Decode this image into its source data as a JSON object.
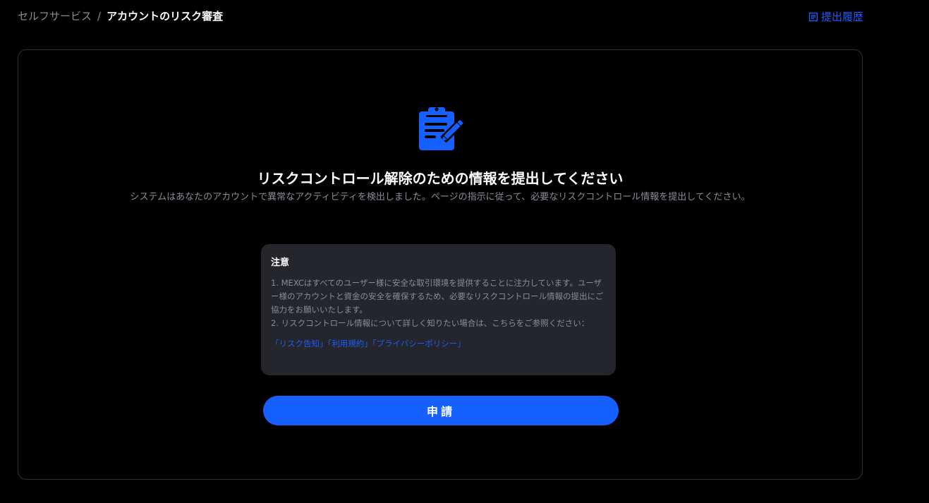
{
  "breadcrumb": {
    "parent": "セルフサービス",
    "separator": "/",
    "current": "アカウントのリスク審査"
  },
  "header": {
    "history_label": "提出履歴",
    "history_icon": "list-document-icon"
  },
  "hero": {
    "icon": "clipboard-edit-icon",
    "title": "リスクコントロール解除のための情報を提出してください",
    "subtitle": "システムはあなたのアカウントで異常なアクティビティを検出しました。ページの指示に従って、必要なリスクコントロール情報を提出してください。"
  },
  "notice": {
    "title": "注意",
    "item1": "1. MEXCはすべてのユーザー様に安全な取引環境を提供することに注力しています。ユーザー様のアカウントと資金の安全を確保するため、必要なリスクコントロール情報の提出にご協力をお願いいたします。",
    "item2": "2. リスクコントロール情報について詳しく知りたい場合は、こちらをご参照ください：",
    "links": [
      "「リスク告知」",
      "「利用規約」",
      "「プライバシーポリシー」"
    ]
  },
  "action": {
    "apply_label": "申請"
  },
  "colors": {
    "accent": "#1660ff",
    "link": "#1a5dff",
    "background": "#000000",
    "panel": "#25262b",
    "muted_text": "#8a8d96"
  }
}
